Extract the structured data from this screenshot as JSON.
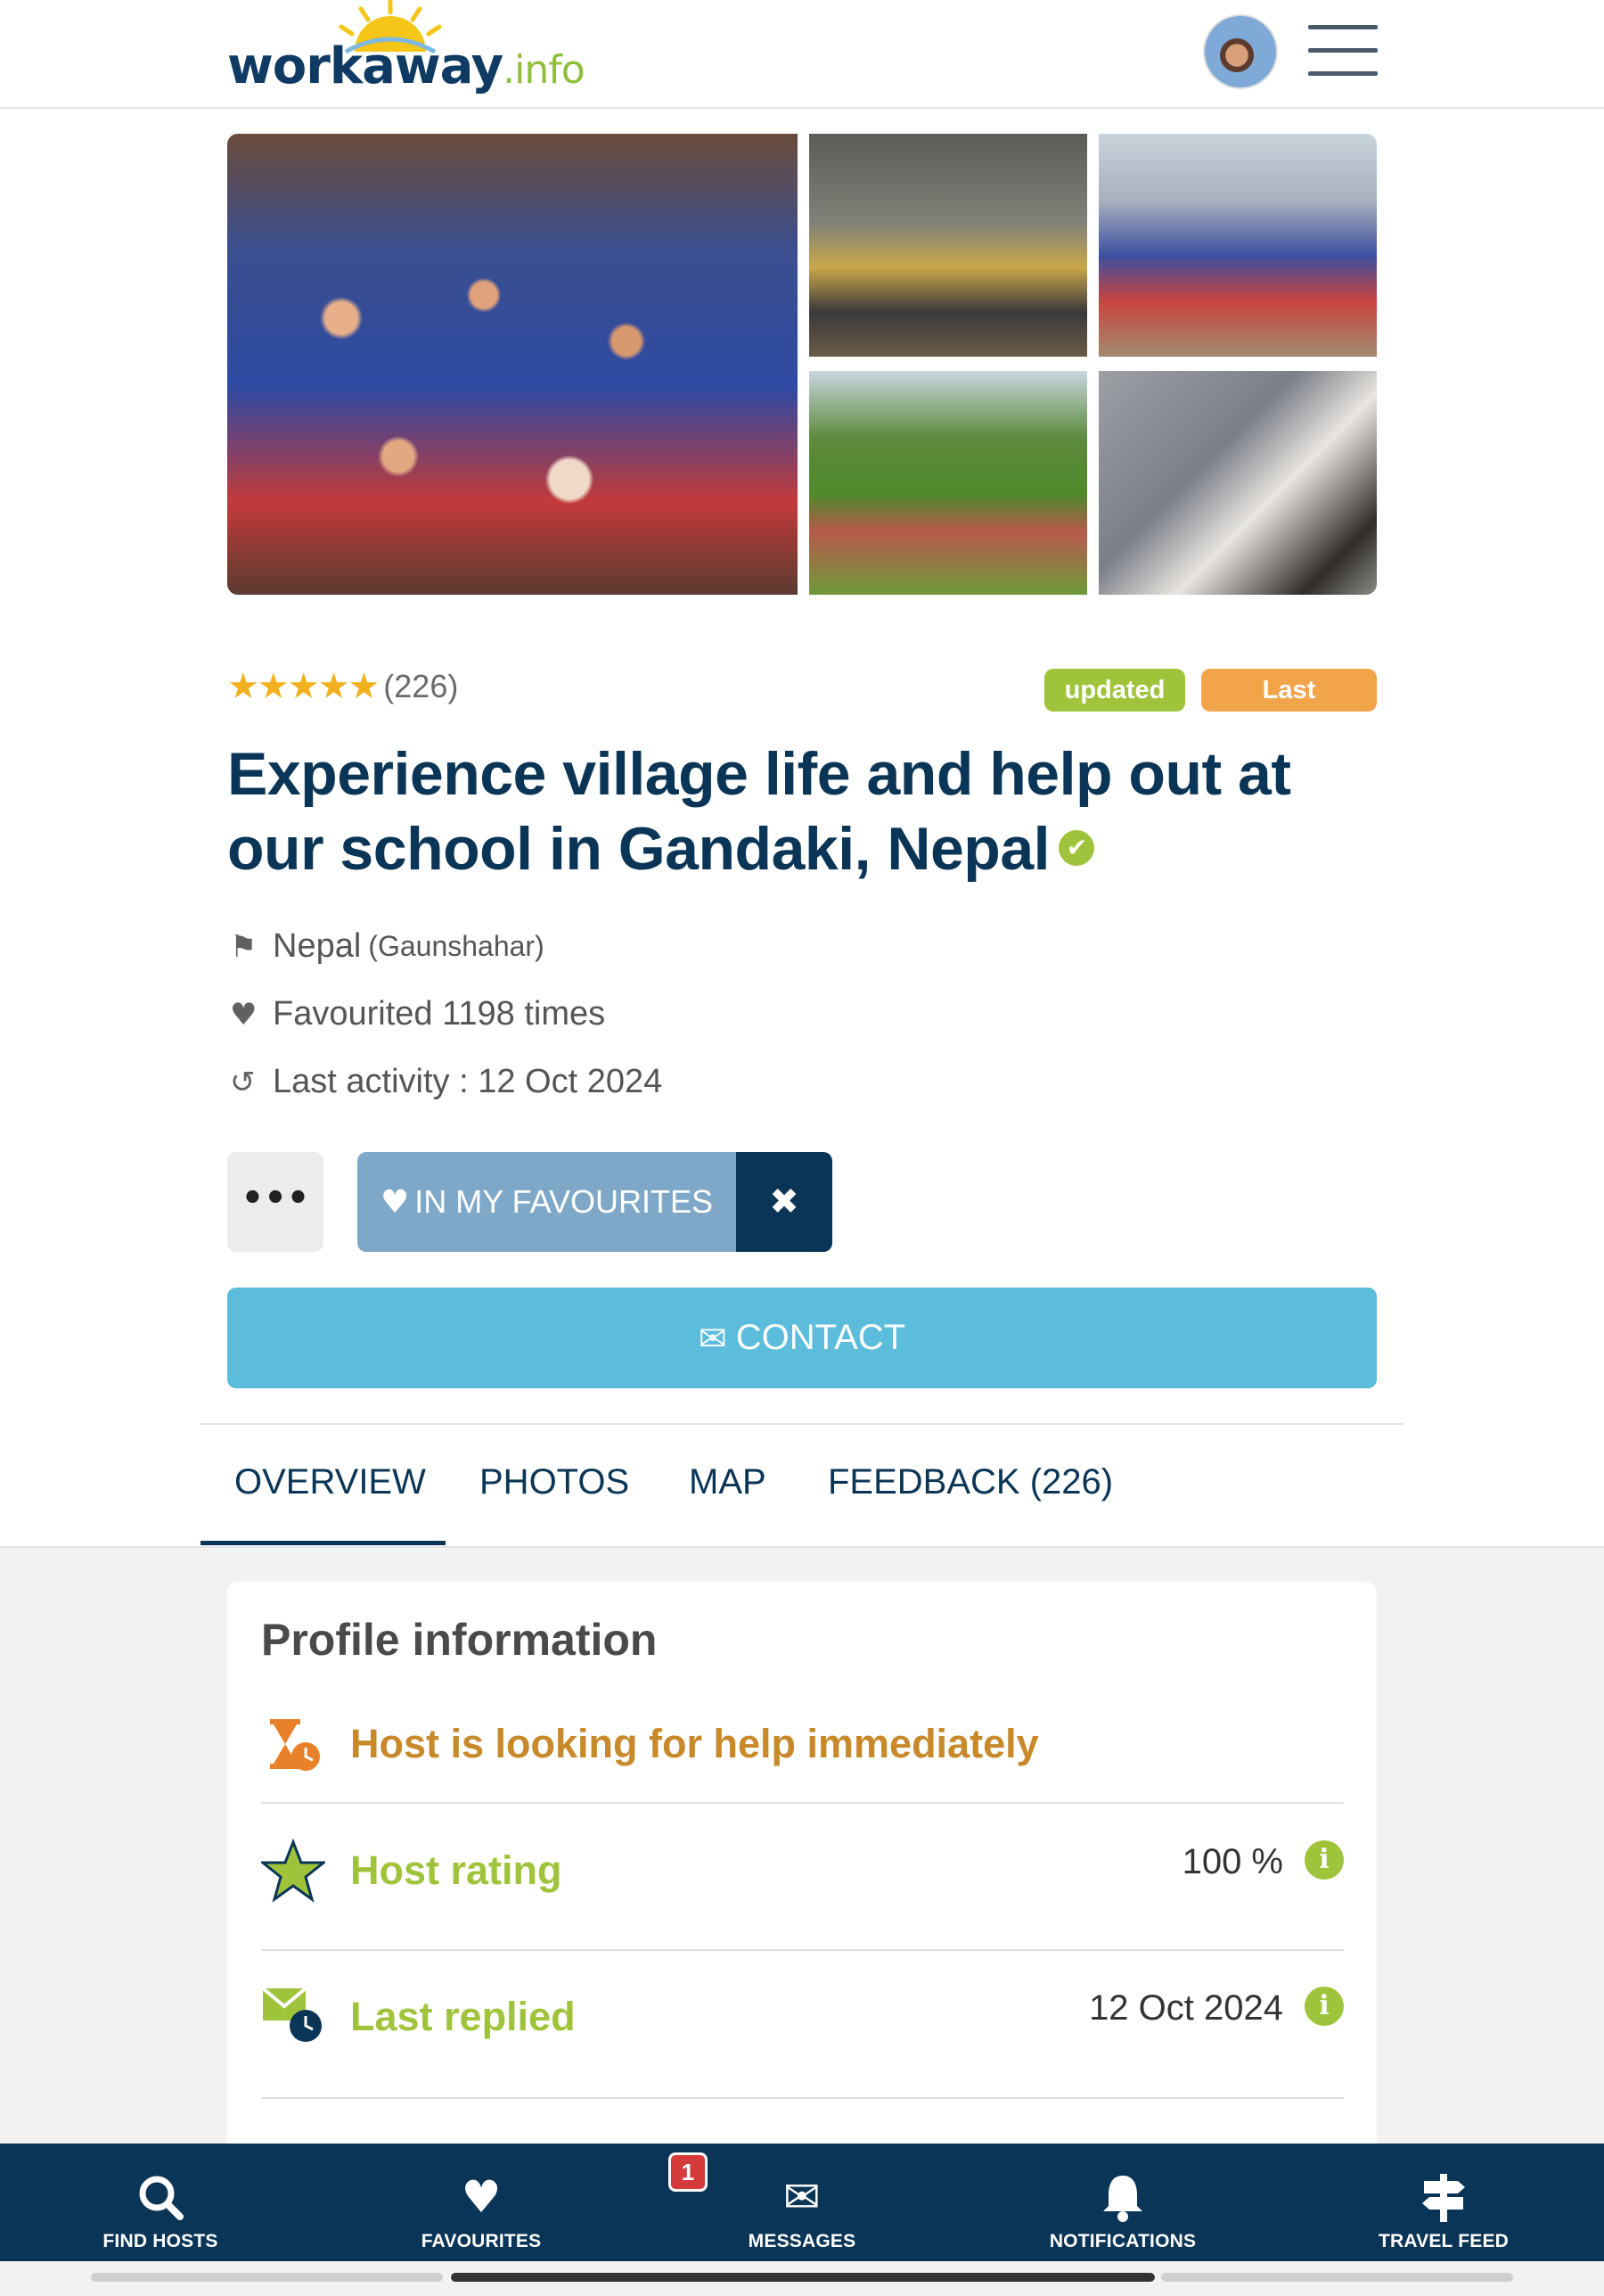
{
  "header": {
    "logo_main": "workaway",
    "logo_suffix": ".info"
  },
  "listing": {
    "rating_stars": 5,
    "review_count": "(226)",
    "badges": {
      "updated": "updated",
      "last_minute": "Last minute"
    },
    "title": "Experience village life and help out at our school in Gandaki, Nepal",
    "country": "Nepal",
    "locality": "(Gaunshahar)",
    "favourited": "Favourited 1198 times",
    "last_activity": "Last activity : 12 Oct 2024"
  },
  "actions": {
    "more": "•••",
    "favourite_label": "IN MY FAVOURITES",
    "remove": "✖",
    "contact_label": "CONTACT"
  },
  "tabs": [
    {
      "label": "OVERVIEW",
      "active": true
    },
    {
      "label": "PHOTOS"
    },
    {
      "label": "MAP"
    },
    {
      "label": "FEEDBACK (226)"
    }
  ],
  "profile": {
    "title": "Profile information",
    "rows": [
      {
        "label": "Host is looking for help immediately",
        "color": "#c8892a",
        "icon": "hourglass-clock-icon"
      },
      {
        "label": "Host rating",
        "value": "100 %",
        "color": "#9fc43b",
        "icon": "star-outline-icon"
      },
      {
        "label": "Last replied",
        "value": "12 Oct 2024",
        "color": "#9fc43b",
        "icon": "envelope-clock-icon"
      }
    ]
  },
  "bottom_nav": [
    {
      "label": "FIND HOSTS",
      "icon": "search-icon"
    },
    {
      "label": "FAVOURITES",
      "icon": "heart-icon"
    },
    {
      "label": "MESSAGES",
      "icon": "envelope-icon",
      "badge": "1"
    },
    {
      "label": "NOTIFICATIONS",
      "icon": "bell-icon"
    },
    {
      "label": "TRAVEL FEED",
      "icon": "signpost-icon"
    }
  ],
  "colors": {
    "navy": "#0b3556",
    "green": "#9fc43b",
    "orange": "#f2a44b",
    "contact_blue": "#5bbcdb",
    "favourite_blue": "#7fa8c8"
  }
}
